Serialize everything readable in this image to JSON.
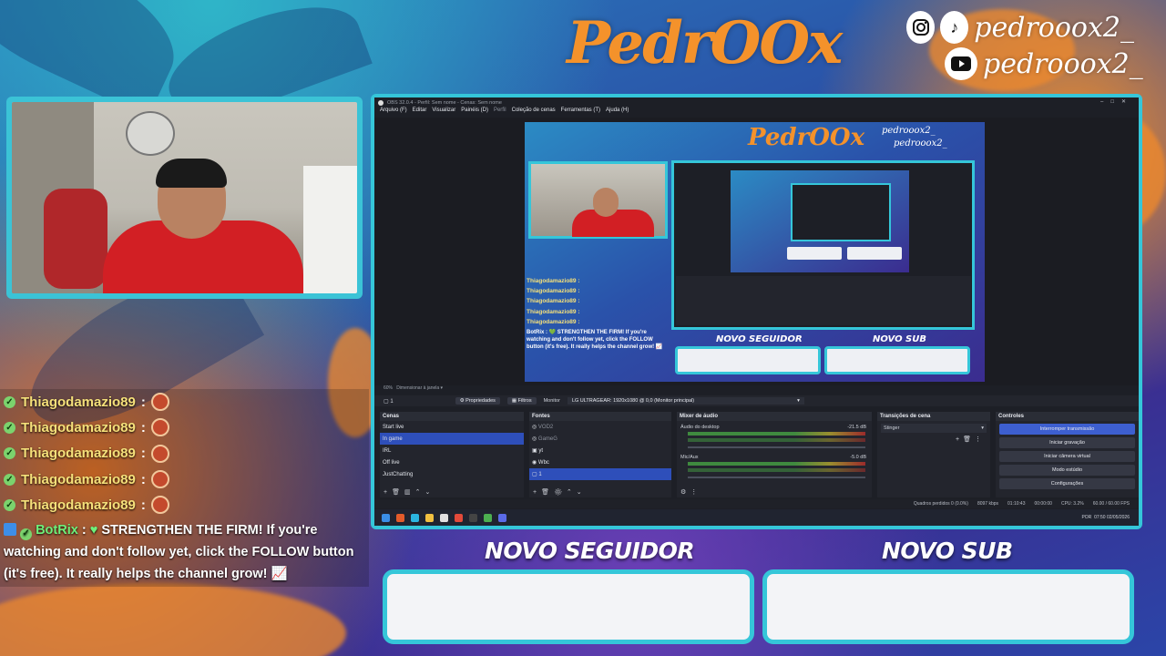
{
  "brand": {
    "logo_text": "PedrOOx",
    "handle_top": "pedrooox2_",
    "handle_bottom": "pedrooox2_"
  },
  "chat": {
    "messages": [
      {
        "user": "Thiagodamazio89",
        "sep": ":"
      },
      {
        "user": "Thiagodamazio89",
        "sep": ":"
      },
      {
        "user": "Thiagodamazio89",
        "sep": ":"
      },
      {
        "user": "Thiagodamazio89",
        "sep": ":"
      },
      {
        "user": "Thiagodamazio89",
        "sep": ":"
      }
    ],
    "bot": {
      "user": "BotRix",
      "sep": ":",
      "text": "STRENGTHEN THE FIRM! If you're watching and don't follow yet, click the FOLLOW button (it's free). It really helps the channel grow! 📈"
    }
  },
  "alerts": {
    "follower_label": "NOVO SEGUIDOR",
    "sub_label": "NOVO SUB"
  },
  "obs": {
    "title": "OBS 32.0.4 - Perfil: Sem nome - Cenas: Sem nome",
    "menu": [
      "Arquivo (F)",
      "Editar",
      "Visualizar",
      "Painéis (D)",
      "Perfil",
      "Coleção de cenas",
      "Ferramentas (T)",
      "Ajuda (H)"
    ],
    "zoom": "60%",
    "zoom_mode": "Dimensionar à janela",
    "source_name": "1",
    "toolbar": {
      "properties": "Propriedades",
      "filters": "Filtros",
      "monitor_label": "Monitor",
      "monitor_value": "LG ULTRAGEAR: 1920x1080 @ 0,0 (Monitor principal)"
    },
    "scenes": {
      "title": "Cenas",
      "items": [
        "Start live",
        "In game",
        "IRL",
        "Off live",
        "JustChatting"
      ],
      "selected": "In game"
    },
    "sources": {
      "title": "Fontes",
      "items": [
        "VOD2",
        "GameG",
        "yt",
        "Wbc",
        "1"
      ],
      "selected": "1"
    },
    "mixer": {
      "title": "Mixer de áudio",
      "channels": [
        {
          "name": "Áudio do desktop",
          "db": "-21.5 dB"
        },
        {
          "name": "Mic/Aux",
          "db": "-5.0 dB"
        }
      ]
    },
    "transitions": {
      "title": "Transições de cena",
      "value": "Stinger"
    },
    "controls": {
      "title": "Controles",
      "buttons": [
        "Interromper transmissão",
        "Iniciar gravação",
        "Iniciar câmera virtual",
        "Modo estúdio",
        "Configurações"
      ]
    },
    "status": {
      "dropped": "Quadros perdidos 0 (0.0%)",
      "bitrate": "8097 kbps",
      "live_time": "01:10:43",
      "rec_time": "00:00:00",
      "cpu": "CPU: 3.2%",
      "fps": "60.00 / 60.00 FPS"
    },
    "clock": {
      "time": "07:50",
      "date": "02/05/2026",
      "lang": "POR"
    }
  },
  "preview": {
    "chat_lines": [
      "Thiagodamazio89 :",
      "Thiagodamazio89 :",
      "Thiagodamazio89 :",
      "Thiagodamazio89 :",
      "Thiagodamazio89 :"
    ],
    "bot_line": "BotRix : 💚 STRENGTHEN THE FIRM! If you're watching and don't follow yet, click the FOLLOW button (it's free). It really helps the channel grow! 📈",
    "follower_label": "NOVO SEGUIDOR",
    "sub_label": "NOVO SUB"
  },
  "colors": {
    "accent_cyan": "#35c6d9",
    "brand_orange": "#f4922b",
    "chat_user": "#f5e07a",
    "bot_green": "#6ef07a",
    "obs_selected": "#2e4fba"
  }
}
